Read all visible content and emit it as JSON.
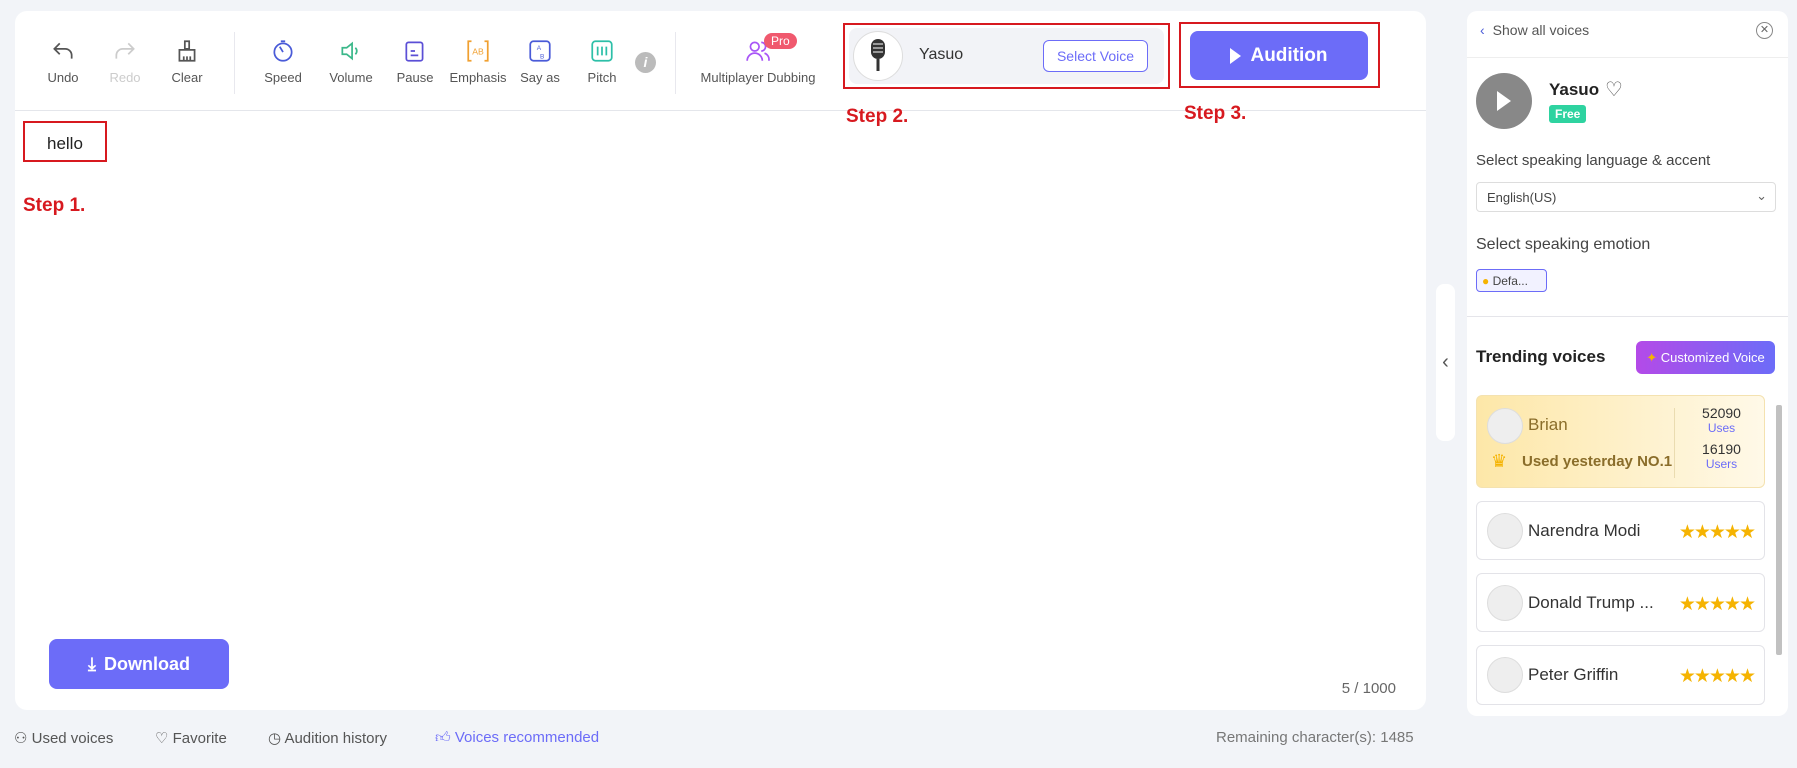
{
  "toolbar": {
    "undo": "Undo",
    "redo": "Redo",
    "clear": "Clear",
    "speed": "Speed",
    "volume": "Volume",
    "pause": "Pause",
    "emphasis": "Emphasis",
    "say_as": "Say as",
    "pitch": "Pitch",
    "multiplayer": "Multiplayer Dubbing",
    "pro_badge": "Pro"
  },
  "voice": {
    "name": "Yasuo",
    "select_label": "Select Voice"
  },
  "audition_label": "Audition",
  "steps": {
    "s1": "Step 1.",
    "s2": "Step 2.",
    "s3": "Step 3."
  },
  "editor": {
    "text": "hello",
    "count": "5 / 1000"
  },
  "download_label": "Download",
  "panel": {
    "show_all": "Show all voices",
    "voice_name": "Yasuo",
    "free_badge": "Free",
    "lang_label": "Select speaking language & accent",
    "lang_value": "English(US)",
    "emotion_label": "Select speaking emotion",
    "emotion_value": "Defa...",
    "trending_title": "Trending voices",
    "customized_label": "Customized Voice",
    "top": {
      "name": "Brian",
      "badge": "Used yesterday NO.1",
      "uses": "52090",
      "uses_label": "Uses",
      "users": "16190",
      "users_label": "Users"
    },
    "voices": [
      {
        "name": "Narendra Modi",
        "rating": 5
      },
      {
        "name": "Donald Trump ...",
        "rating": 5
      },
      {
        "name": "Peter Griffin",
        "rating": 5
      }
    ]
  },
  "bottom": {
    "used": "Used voices",
    "favorite": "Favorite",
    "history": "Audition history",
    "recommended": "Voices recommended",
    "remaining": "Remaining character(s): 1485"
  },
  "colors": {
    "accent": "#6c6cf8",
    "step_red": "#d7191f",
    "free_green": "#2ed3a0",
    "star": "#f5b301"
  }
}
